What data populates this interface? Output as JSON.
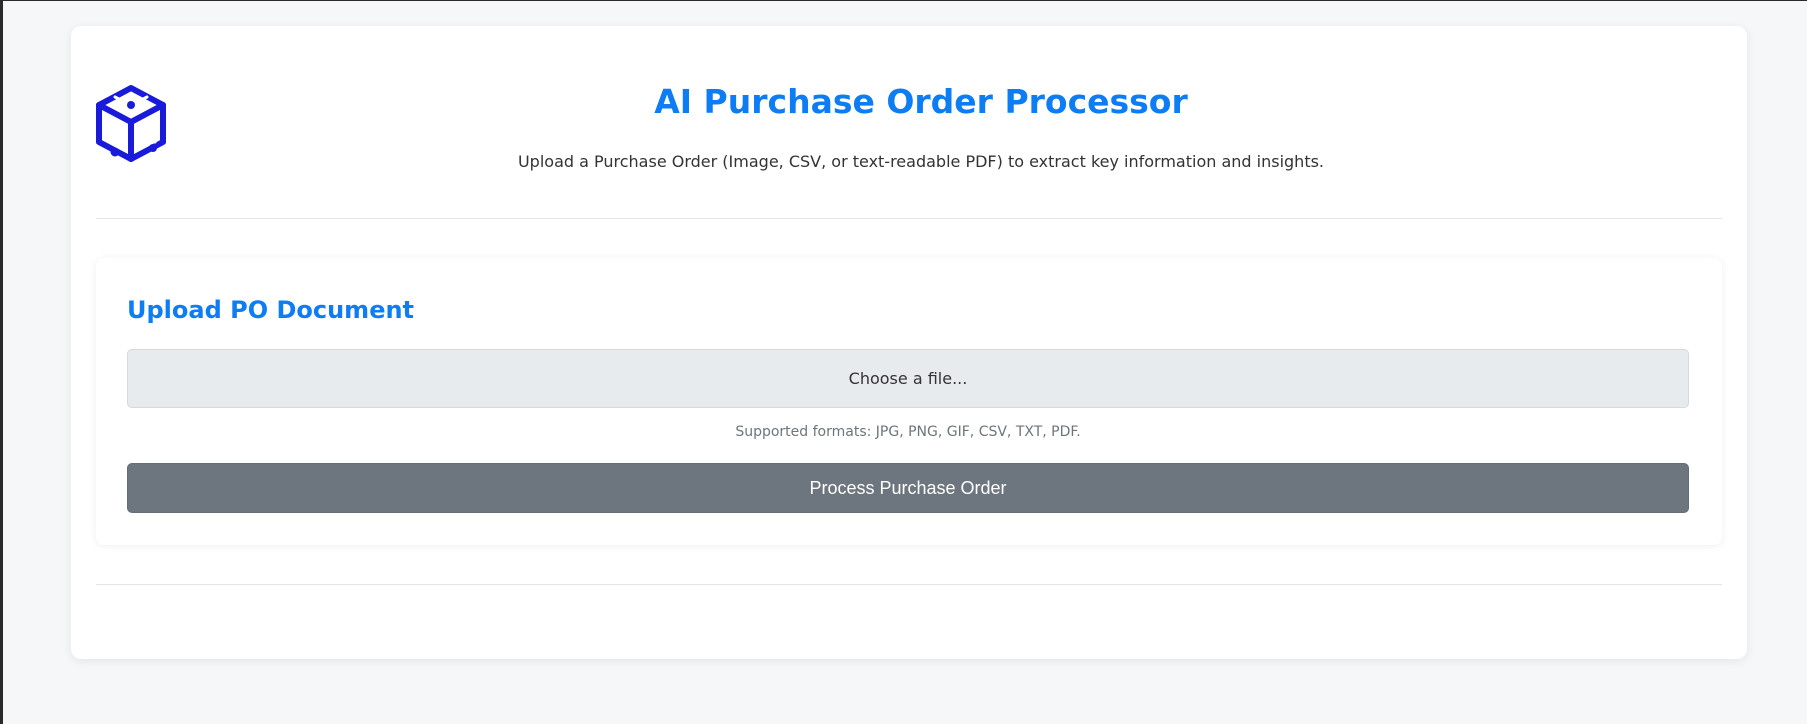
{
  "header": {
    "logo_icon": "cube-circuit-logo-icon",
    "title": "AI Purchase Order Processor",
    "subtitle": "Upload a Purchase Order (Image, CSV, or text-readable PDF) to extract key information and insights."
  },
  "upload": {
    "heading": "Upload PO Document",
    "file_picker_label": "Choose a file...",
    "formats_note": "Supported formats: JPG, PNG, GIF, CSV, TXT, PDF.",
    "process_button_label": "Process Purchase Order"
  },
  "colors": {
    "accent": "#0d7df5",
    "logo": "#1a1adb",
    "button": "#6d757e",
    "picker_bg": "#e8ebee",
    "page_bg": "#f6f7f9"
  }
}
